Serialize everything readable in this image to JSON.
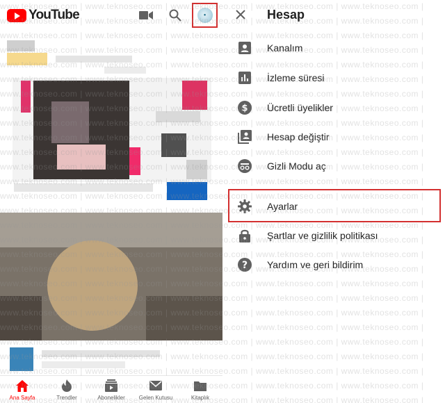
{
  "left": {
    "logo_text": "YouTube",
    "nav": [
      {
        "label": "Ana Sayfa",
        "icon": "home-icon",
        "active": true
      },
      {
        "label": "Trendler",
        "icon": "trending-icon",
        "active": false
      },
      {
        "label": "Abonelikler",
        "icon": "subscriptions-icon",
        "active": false
      },
      {
        "label": "Gelen Kutusu",
        "icon": "inbox-icon",
        "active": false
      },
      {
        "label": "Kitaplık",
        "icon": "library-icon",
        "active": false
      }
    ]
  },
  "account": {
    "title": "Hesap",
    "items": [
      {
        "label": "Kanalım",
        "icon": "person-box-icon"
      },
      {
        "label": "İzleme süresi",
        "icon": "bar-chart-icon"
      },
      {
        "label": "Ücretli üyelikler",
        "icon": "dollar-circle-icon"
      },
      {
        "label": "Hesap değiştir",
        "icon": "switch-account-icon"
      },
      {
        "label": "Gizli Modu aç",
        "icon": "incognito-icon"
      },
      {
        "label": "Ayarlar",
        "icon": "gear-icon"
      },
      {
        "label": "Şartlar ve gizlilik politikası",
        "icon": "lock-icon"
      },
      {
        "label": "Yardım ve geri bildirim",
        "icon": "help-circle-icon"
      }
    ]
  },
  "watermark": "www.teknoseo.com",
  "colors": {
    "brand_red": "#ff0000",
    "icon_grey": "#606060",
    "annotation_red": "#d32f2f"
  }
}
